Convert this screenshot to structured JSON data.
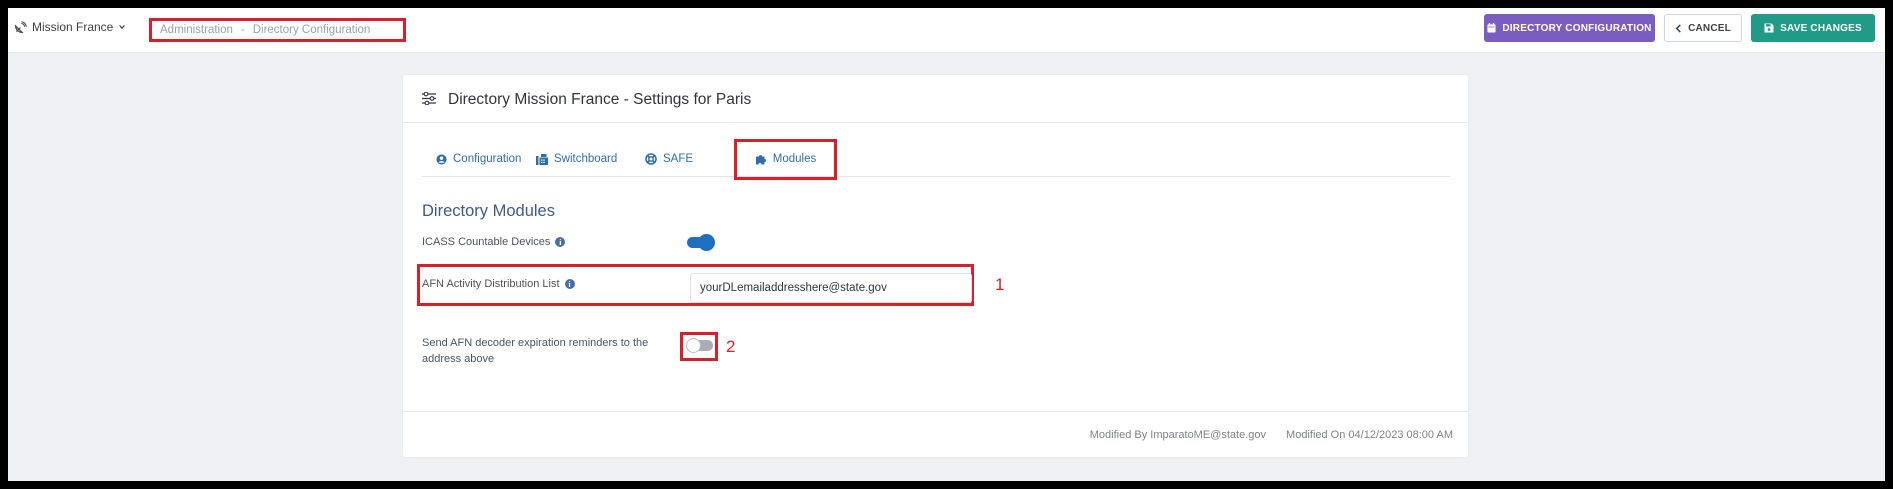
{
  "topbar": {
    "mission_label": "Mission France",
    "breadcrumb": {
      "part1": "Administration",
      "separator": "-",
      "part2": "Directory Configuration"
    },
    "buttons": {
      "directory_configuration": "DIRECTORY CONFIGURATION",
      "cancel": "CANCEL",
      "save_changes": "SAVE CHANGES"
    }
  },
  "card": {
    "title": "Directory Mission France - Settings for Paris",
    "tabs": [
      {
        "label": "Configuration",
        "icon": "user-circle-icon"
      },
      {
        "label": "Switchboard",
        "icon": "fax-icon"
      },
      {
        "label": "SAFE",
        "icon": "life-ring-icon"
      },
      {
        "label": "Modules",
        "icon": "puzzle-piece-icon",
        "active": true
      }
    ],
    "section_title": "Directory Modules",
    "fields": {
      "icass_label": "ICASS Countable Devices",
      "icass_enabled": true,
      "afn_label": "AFN Activity Distribution List",
      "afn_value": "yourDLemailaddresshere@state.gov",
      "reminder_label_line1": "Send AFN decoder expiration reminders to the",
      "reminder_label_line2": "address above",
      "reminder_enabled": false
    },
    "annotations": {
      "one": "1",
      "two": "2"
    },
    "footer": {
      "modified_by": "Modified By ImparatoME@state.gov",
      "modified_on": "Modified On 04/12/2023 08:00 AM"
    }
  },
  "colors": {
    "purple_button": "#7b5cc0",
    "teal_button": "#1f9b88",
    "highlight_red": "#d6202c",
    "toggle_on": "#1f6fbf",
    "link_blue": "#2f6fa8"
  }
}
